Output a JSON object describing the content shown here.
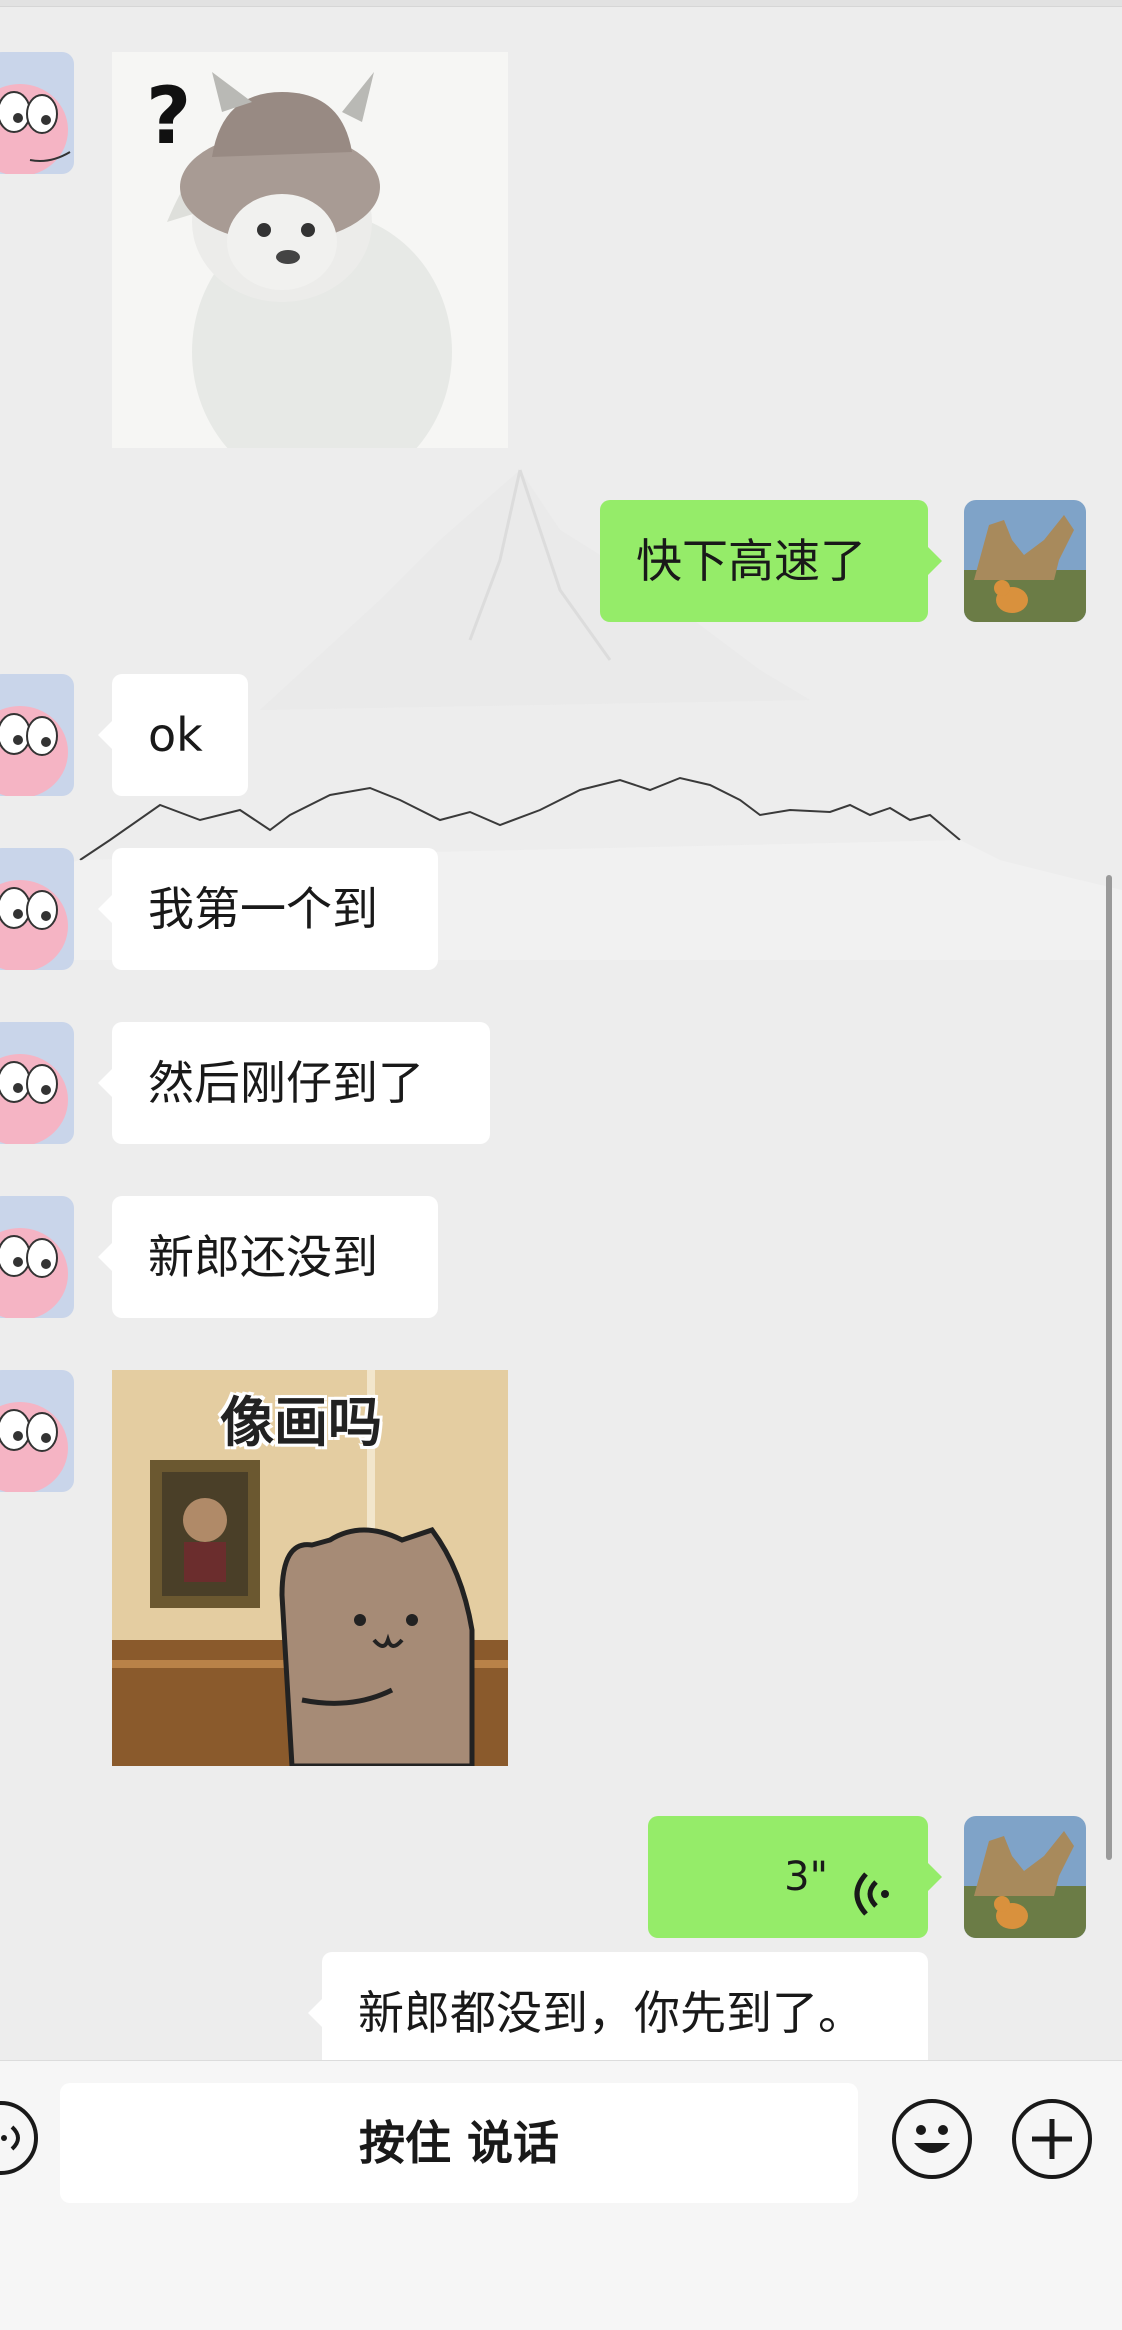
{
  "messages": [
    {
      "side": "left",
      "type": "sticker",
      "sticker": {
        "text": "?",
        "name": "cowboy-cat"
      }
    },
    {
      "side": "right",
      "type": "text",
      "text": "快下高速了"
    },
    {
      "side": "left",
      "type": "text",
      "text": "ok"
    },
    {
      "side": "left",
      "type": "text",
      "text": "我第一个到"
    },
    {
      "side": "left",
      "type": "text",
      "text": "然后刚仔到了"
    },
    {
      "side": "left",
      "type": "text",
      "text": "新郎还没到"
    },
    {
      "side": "left",
      "type": "sticker",
      "sticker": {
        "text": "像画吗",
        "name": "cat-museum"
      }
    },
    {
      "side": "right",
      "type": "voice",
      "duration": "3\""
    },
    {
      "side": "right",
      "type": "text",
      "text": "新郎都没到，你先到了。"
    }
  ],
  "input_bar": {
    "hold_to_talk": "按住 说话",
    "icons": [
      "voice-mode-icon",
      "emoji-icon",
      "plus-icon"
    ]
  },
  "colors": {
    "chat_bg": "#ededed",
    "green_bubble": "#95ec69",
    "white_bubble": "#ffffff",
    "text": "#191919"
  }
}
